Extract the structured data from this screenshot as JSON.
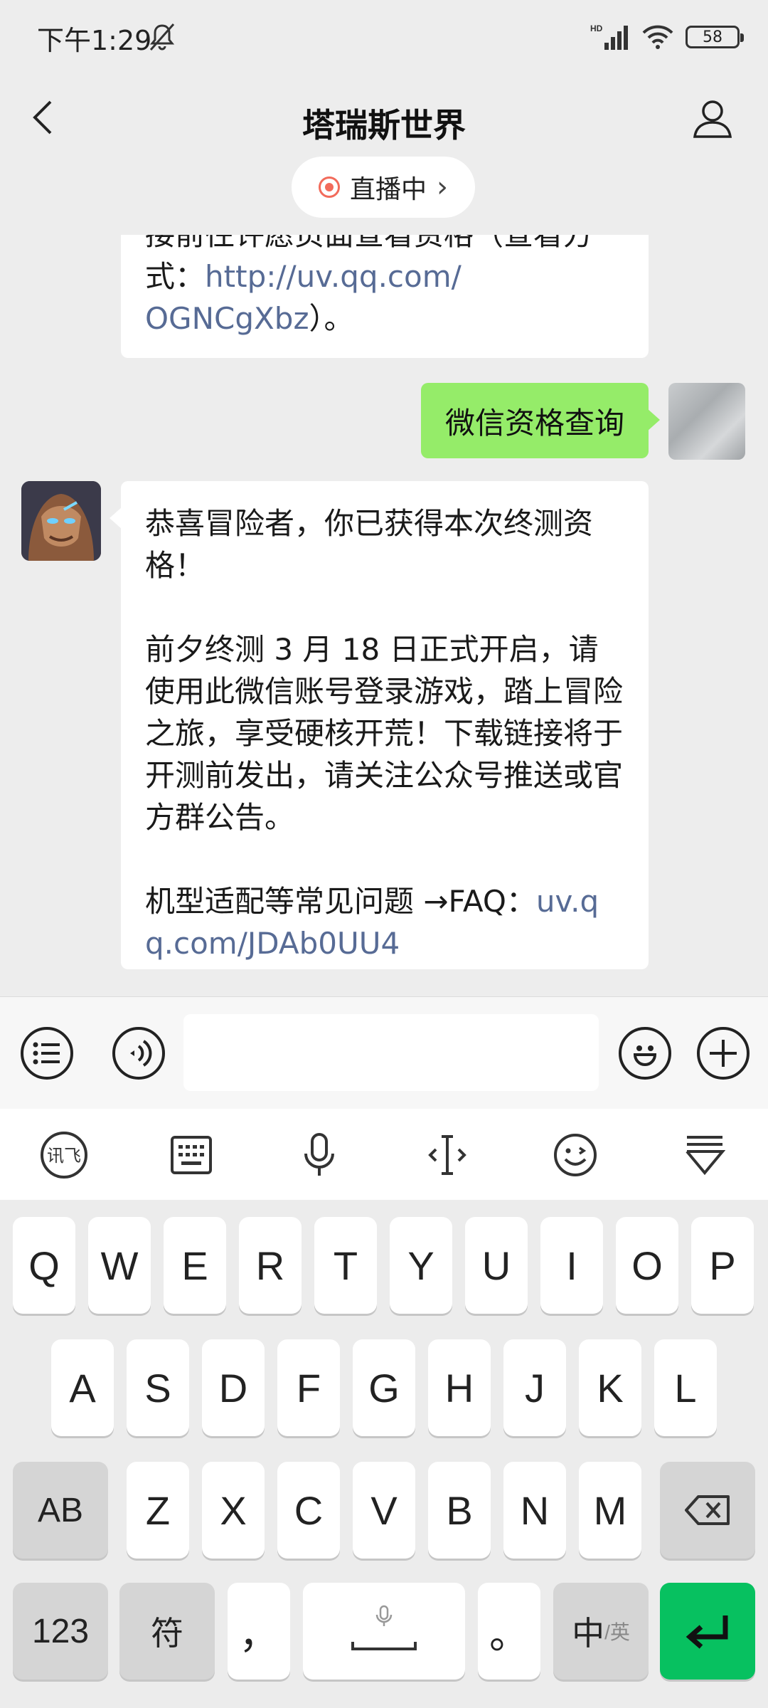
{
  "status_bar": {
    "time": "下午1:29",
    "signal_label": "HD",
    "battery": "58"
  },
  "header": {
    "title": "塔瑞斯世界",
    "live_label": "直播中",
    "live_chevron": "›"
  },
  "messages": {
    "top_partial": {
      "line1": "接前往许愿页面查看资格（查看方",
      "line2_prefix": "式：",
      "link_part1": "http://uv.qq.com/",
      "link_part2": "OGNCgXbz",
      "suffix": "）。"
    },
    "user_msg": "微信资格查询",
    "bot_msg": {
      "para1": "恭喜冒险者，你已获得本次终测资格！",
      "para2": "前夕终测 3 月 18 日正式开启，请使用此微信账号登录游戏，踏上冒险之旅，享受硬核开荒！下载链接将于开测前发出，请关注公众号推送或官方群公告。",
      "para3_prefix": "机型适配等常见问题 →FAQ：",
      "para3_link": "uv.qq.com/JDAb0UU4"
    }
  },
  "input_bar": {
    "value": ""
  },
  "keyboard": {
    "row1": [
      "Q",
      "W",
      "E",
      "R",
      "T",
      "Y",
      "U",
      "I",
      "O",
      "P"
    ],
    "row2": [
      "A",
      "S",
      "D",
      "F",
      "G",
      "H",
      "J",
      "K",
      "L"
    ],
    "row3": [
      "Z",
      "X",
      "C",
      "V",
      "B",
      "N",
      "M"
    ],
    "shift_label": "AB",
    "numbers_label": "123",
    "symbols_label": "符",
    "comma_label": "，",
    "period_label": "。",
    "lang_main": "中",
    "lang_sub": "/英"
  },
  "icons": {
    "back": "chevron-left-icon",
    "profile": "user-icon",
    "list": "list-icon",
    "voice": "voice-icon",
    "emoji": "emoji-icon",
    "add": "plus-icon",
    "backspace": "backspace-icon",
    "enter": "enter-icon"
  },
  "colors": {
    "accent_green": "#07c160",
    "bubble_green": "#95ec69",
    "link": "#576b95",
    "live_red": "#f26b5b"
  }
}
